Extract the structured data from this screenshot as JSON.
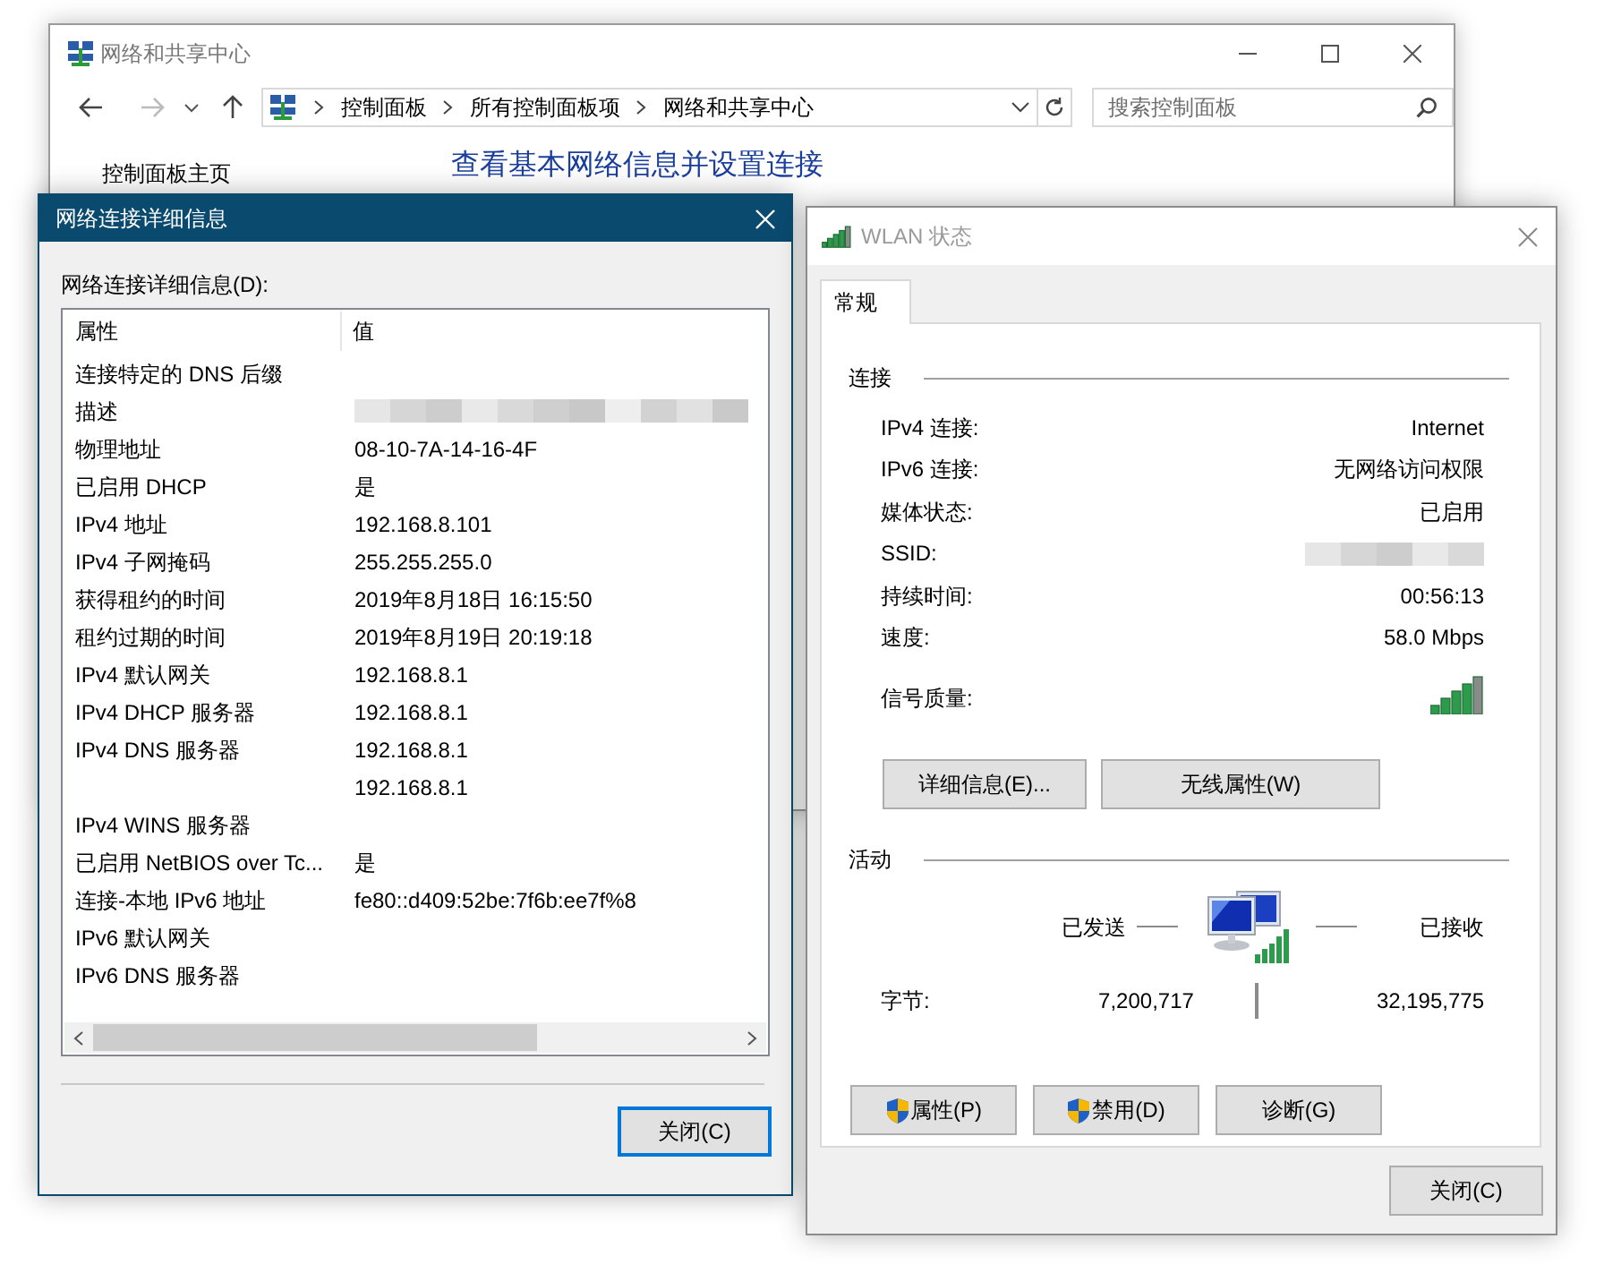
{
  "background_window": {
    "title": "网络和共享中心",
    "breadcrumbs": [
      "控制面板",
      "所有控制面板项",
      "网络和共享中心"
    ],
    "search": {
      "placeholder": "搜索控制面板"
    },
    "heading": "查看基本网络信息并设置连接",
    "sidebar": {
      "items": [
        "控制面板主页"
      ]
    }
  },
  "details_dialog": {
    "title": "网络连接详细信息",
    "list_label": "网络连接详细信息(D):",
    "table": {
      "columns": [
        "属性",
        "值"
      ],
      "rows": [
        {
          "kind": "text",
          "property": "连接特定的 DNS 后缀"
        },
        {
          "kind": "redacted",
          "property": "描述"
        },
        {
          "kind": "text",
          "property": "物理地址",
          "value": "08-10-7A-14-16-4F"
        },
        {
          "kind": "text",
          "property": "已启用 DHCP",
          "value": "是"
        },
        {
          "kind": "text",
          "property": "IPv4 地址",
          "value": "192.168.8.101"
        },
        {
          "kind": "text",
          "property": "IPv4 子网掩码",
          "value": "255.255.255.0"
        },
        {
          "kind": "text",
          "property": "获得租约的时间",
          "value": "2019年8月18日 16:15:50"
        },
        {
          "kind": "text",
          "property": "租约过期的时间",
          "value": "2019年8月19日 20:19:18"
        },
        {
          "kind": "text",
          "property": "IPv4 默认网关",
          "value": "192.168.8.1"
        },
        {
          "kind": "text",
          "property": "IPv4 DHCP 服务器",
          "value": "192.168.8.1"
        },
        {
          "kind": "text",
          "property": "IPv4 DNS 服务器",
          "value": "192.168.8.1"
        },
        {
          "kind": "text",
          "value": "192.168.8.1"
        },
        {
          "kind": "text",
          "property": "IPv4 WINS 服务器"
        },
        {
          "kind": "text",
          "property": "已启用 NetBIOS over Tc...",
          "value": "是"
        },
        {
          "kind": "text",
          "property": "连接-本地 IPv6 地址",
          "value": "fe80::d409:52be:7f6b:ee7f%8"
        },
        {
          "kind": "text",
          "property": "IPv6 默认网关"
        },
        {
          "kind": "text",
          "property": "IPv6 DNS 服务器"
        }
      ]
    },
    "close_button": "关闭(C)"
  },
  "wlan_dialog": {
    "title": "WLAN 状态",
    "tabs": [
      {
        "label": "常规",
        "selected": true
      }
    ],
    "connection": {
      "heading": "连接",
      "rows": [
        {
          "kind": "text",
          "label": "IPv4 连接:",
          "value": "Internet"
        },
        {
          "kind": "text",
          "label": "IPv6 连接:",
          "value": "无网络访问权限"
        },
        {
          "kind": "text",
          "label": "媒体状态:",
          "value": "已启用"
        },
        {
          "kind": "redacted",
          "label": "SSID:"
        },
        {
          "kind": "text",
          "label": "持续时间:",
          "value": "00:56:13"
        },
        {
          "kind": "text",
          "label": "速度:",
          "value": "58.0 Mbps"
        },
        {
          "kind": "signal",
          "label": "信号质量:"
        }
      ]
    },
    "buttons": [
      "详细信息(E)...",
      "无线属性(W)"
    ],
    "activity": {
      "heading": "活动",
      "sent_label": "已发送",
      "received_label": "已接收",
      "bytes_label": "字节:",
      "sent": "7,200,717",
      "received": "32,195,775"
    },
    "action_buttons": [
      {
        "label": "属性(P)",
        "shield": true
      },
      {
        "label": "禁用(D)",
        "shield": true
      },
      {
        "label": "诊断(G)",
        "shield": false
      }
    ],
    "close_button": "关闭(C)"
  }
}
